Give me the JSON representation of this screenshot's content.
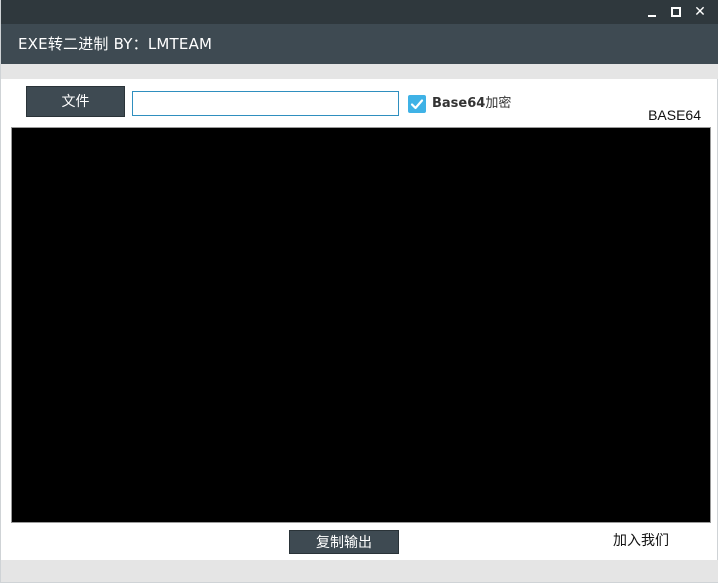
{
  "window": {
    "title": "EXE转二进制 BY：LMTEAM",
    "controls": {
      "minimize_icon": "minimize-icon",
      "maximize_icon": "maximize-icon",
      "close_icon": "close-icon"
    }
  },
  "toolbar": {
    "file_button_label": "文件",
    "path_input_value": "",
    "path_input_placeholder": "",
    "base64_checkbox": {
      "checked": true,
      "label_bold": "Base64",
      "label_rest": "加密"
    }
  },
  "mode_label": "BASE64",
  "output": {
    "value": ""
  },
  "footer": {
    "copy_button_label": "复制输出",
    "join_link_label": "加入我们"
  },
  "colors": {
    "topbar": "#2f383d",
    "titlebar": "#3e4a52",
    "accent": "#3fb2e6",
    "output_bg": "#000000"
  }
}
